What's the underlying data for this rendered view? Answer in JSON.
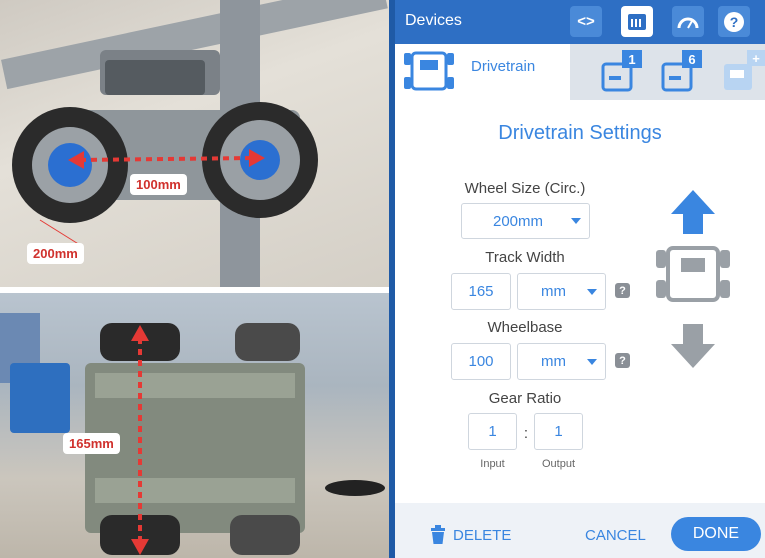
{
  "photos": {
    "top_label_wheel_track": "100mm",
    "top_label_wheel_size": "200mm",
    "bottom_label_track_width": "165mm"
  },
  "header": {
    "title": "Devices",
    "icons": [
      "code-icon",
      "brain-port-icon",
      "dashboard-gauge-icon",
      "help-icon"
    ]
  },
  "tabs": {
    "active_label": "Drivetrain",
    "port_badges": [
      "1",
      "6",
      "+"
    ]
  },
  "settings": {
    "heading": "Drivetrain Settings",
    "wheel_size": {
      "label": "Wheel Size (Circ.)",
      "value": "200mm"
    },
    "track_width": {
      "label": "Track Width",
      "value": "165",
      "unit": "mm"
    },
    "wheelbase": {
      "label": "Wheelbase",
      "value": "100",
      "unit": "mm"
    },
    "gear_ratio": {
      "label": "Gear Ratio",
      "input": "1",
      "output": "1",
      "input_label": "Input",
      "output_label": "Output",
      "separator": ":"
    },
    "help_glyph": "?"
  },
  "footer": {
    "delete_label": "DELETE",
    "cancel_label": "CANCEL",
    "done_label": "DONE"
  },
  "colors": {
    "header_blue": "#2e6fc4",
    "accent": "#3a86e0",
    "arrow_red": "#e53935"
  }
}
